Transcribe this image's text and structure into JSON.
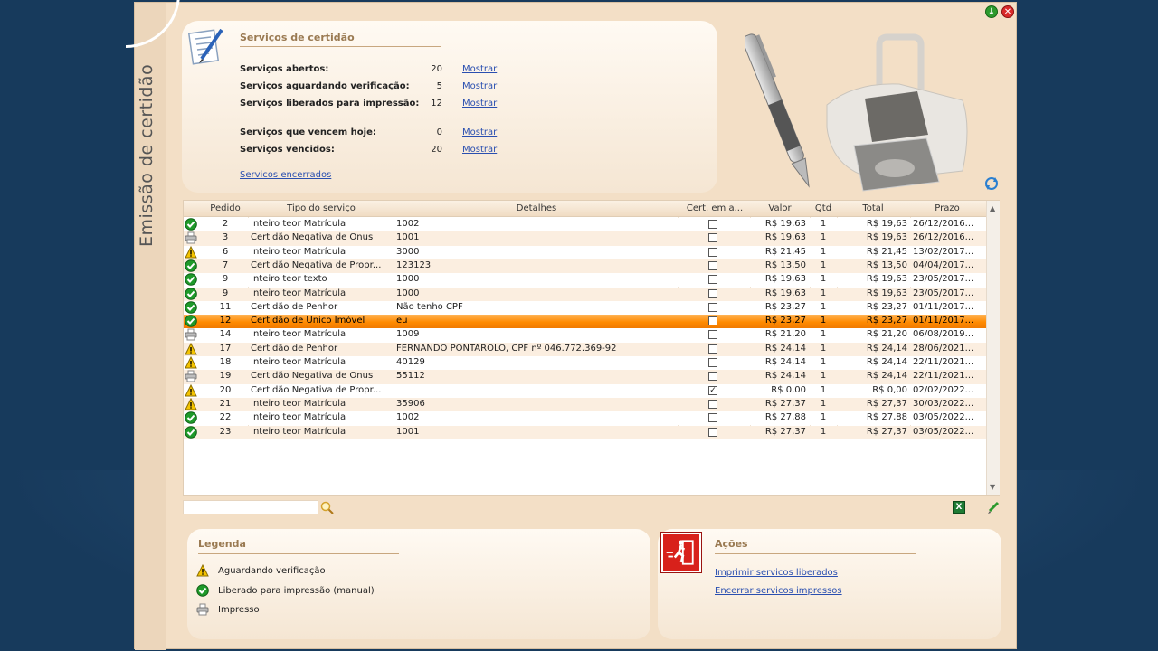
{
  "app": {
    "vertical_title": "Emissão de certidão"
  },
  "summary": {
    "title": "Serviços de certidão",
    "stats": [
      {
        "label": "Serviços abertos:",
        "value": "20",
        "link": "Mostrar"
      },
      {
        "label": "Serviços aguardando verificação:",
        "value": "5",
        "link": "Mostrar"
      },
      {
        "label": "Serviços liberados para impressão:",
        "value": "12",
        "link": "Mostrar"
      },
      {
        "label": "Serviços que vencem hoje:",
        "value": "0",
        "link": "Mostrar"
      },
      {
        "label": "Serviços vencidos:",
        "value": "20",
        "link": "Mostrar"
      }
    ],
    "closed_link": "Servicos encerrados"
  },
  "table": {
    "columns": [
      "Pedido",
      "Tipo do serviço",
      "Detalhes",
      "Cert. em a...",
      "Valor",
      "Qtd",
      "Total",
      "Prazo"
    ],
    "rows": [
      {
        "status": "liberado",
        "pedido": "2",
        "tipo": "Inteiro teor Matrícula",
        "detalhes": "1002",
        "cert": false,
        "valor": "R$ 19,63",
        "qtd": "1",
        "total": "R$ 19,63",
        "prazo": "26/12/2016..."
      },
      {
        "status": "impresso",
        "pedido": "3",
        "tipo": "Certidão Negativa de Ônus",
        "detalhes": "1001",
        "cert": false,
        "valor": "R$ 19,63",
        "qtd": "1",
        "total": "R$ 19,63",
        "prazo": "26/12/2016..."
      },
      {
        "status": "aguardando",
        "pedido": "6",
        "tipo": "Inteiro teor Matrícula",
        "detalhes": "3000",
        "cert": false,
        "valor": "R$ 21,45",
        "qtd": "1",
        "total": "R$ 21,45",
        "prazo": "13/02/2017..."
      },
      {
        "status": "liberado",
        "pedido": "7",
        "tipo": "Certidão Negativa de Propr...",
        "detalhes": "123123",
        "cert": false,
        "valor": "R$ 13,50",
        "qtd": "1",
        "total": "R$ 13,50",
        "prazo": "04/04/2017..."
      },
      {
        "status": "liberado",
        "pedido": "9",
        "tipo": "Inteiro teor texto",
        "detalhes": "1000",
        "cert": false,
        "valor": "R$ 19,63",
        "qtd": "1",
        "total": "R$ 19,63",
        "prazo": "23/05/2017..."
      },
      {
        "status": "liberado",
        "pedido": "9",
        "tipo": "Inteiro teor Matrícula",
        "detalhes": "1000",
        "cert": false,
        "valor": "R$ 19,63",
        "qtd": "1",
        "total": "R$ 19,63",
        "prazo": "23/05/2017..."
      },
      {
        "status": "liberado",
        "pedido": "11",
        "tipo": "Certidão de Penhor",
        "detalhes": "Não tenho CPF",
        "cert": false,
        "valor": "R$ 23,27",
        "qtd": "1",
        "total": "R$ 23,27",
        "prazo": "01/11/2017..."
      },
      {
        "status": "liberado",
        "pedido": "12",
        "tipo": "Certidão de Unico Imóvel",
        "detalhes": "eu",
        "cert": false,
        "valor": "R$ 23,27",
        "qtd": "1",
        "total": "R$ 23,27",
        "prazo": "01/11/2017...",
        "selected": true
      },
      {
        "status": "impresso",
        "pedido": "14",
        "tipo": "Inteiro teor Matrícula",
        "detalhes": "1009",
        "cert": false,
        "valor": "R$ 21,20",
        "qtd": "1",
        "total": "R$ 21,20",
        "prazo": "06/08/2019..."
      },
      {
        "status": "aguardando",
        "pedido": "17",
        "tipo": "Certidão de Penhor",
        "detalhes": "FERNANDO PONTAROLO, CPF nº 046.772.369-92",
        "cert": false,
        "valor": "R$ 24,14",
        "qtd": "1",
        "total": "R$ 24,14",
        "prazo": "28/06/2021..."
      },
      {
        "status": "aguardando",
        "pedido": "18",
        "tipo": "Inteiro teor Matrícula",
        "detalhes": "40129",
        "cert": false,
        "valor": "R$ 24,14",
        "qtd": "1",
        "total": "R$ 24,14",
        "prazo": "22/11/2021..."
      },
      {
        "status": "impresso",
        "pedido": "19",
        "tipo": "Certidão Negativa de Ônus",
        "detalhes": "55112",
        "cert": false,
        "valor": "R$ 24,14",
        "qtd": "1",
        "total": "R$ 24,14",
        "prazo": "22/11/2021..."
      },
      {
        "status": "aguardando",
        "pedido": "20",
        "tipo": "Certidão Negativa de Propr...",
        "detalhes": "",
        "cert": true,
        "valor": "R$ 0,00",
        "qtd": "1",
        "total": "R$ 0,00",
        "prazo": "02/02/2022..."
      },
      {
        "status": "aguardando",
        "pedido": "21",
        "tipo": "Inteiro teor Matrícula",
        "detalhes": "35906",
        "cert": false,
        "valor": "R$ 27,37",
        "qtd": "1",
        "total": "R$ 27,37",
        "prazo": "30/03/2022..."
      },
      {
        "status": "liberado",
        "pedido": "22",
        "tipo": "Inteiro teor Matrícula",
        "detalhes": "1002",
        "cert": false,
        "valor": "R$ 27,88",
        "qtd": "1",
        "total": "R$ 27,88",
        "prazo": "03/05/2022..."
      },
      {
        "status": "liberado",
        "pedido": "23",
        "tipo": "Inteiro teor Matrícula",
        "detalhes": "1001",
        "cert": false,
        "valor": "R$ 27,37",
        "qtd": "1",
        "total": "R$ 27,37",
        "prazo": "03/05/2022..."
      }
    ]
  },
  "search": {
    "placeholder": "",
    "value": ""
  },
  "legend": {
    "title": "Legenda",
    "items": [
      {
        "icon": "warning-icon",
        "label": "Aguardando verificação"
      },
      {
        "icon": "check-icon",
        "label": "Liberado para impressão (manual)"
      },
      {
        "icon": "printer-icon",
        "label": "Impresso"
      }
    ]
  },
  "actions": {
    "title": "Ações",
    "links": [
      "Imprimir servicos liberados",
      "Encerrar servicos impressos"
    ]
  },
  "colors": {
    "accent_orange": "#ff8a00",
    "link_blue": "#2a4fb0",
    "panel_title": "#9a7a52",
    "status_green": "#1f9a2a",
    "status_yellow": "#f5c400"
  }
}
